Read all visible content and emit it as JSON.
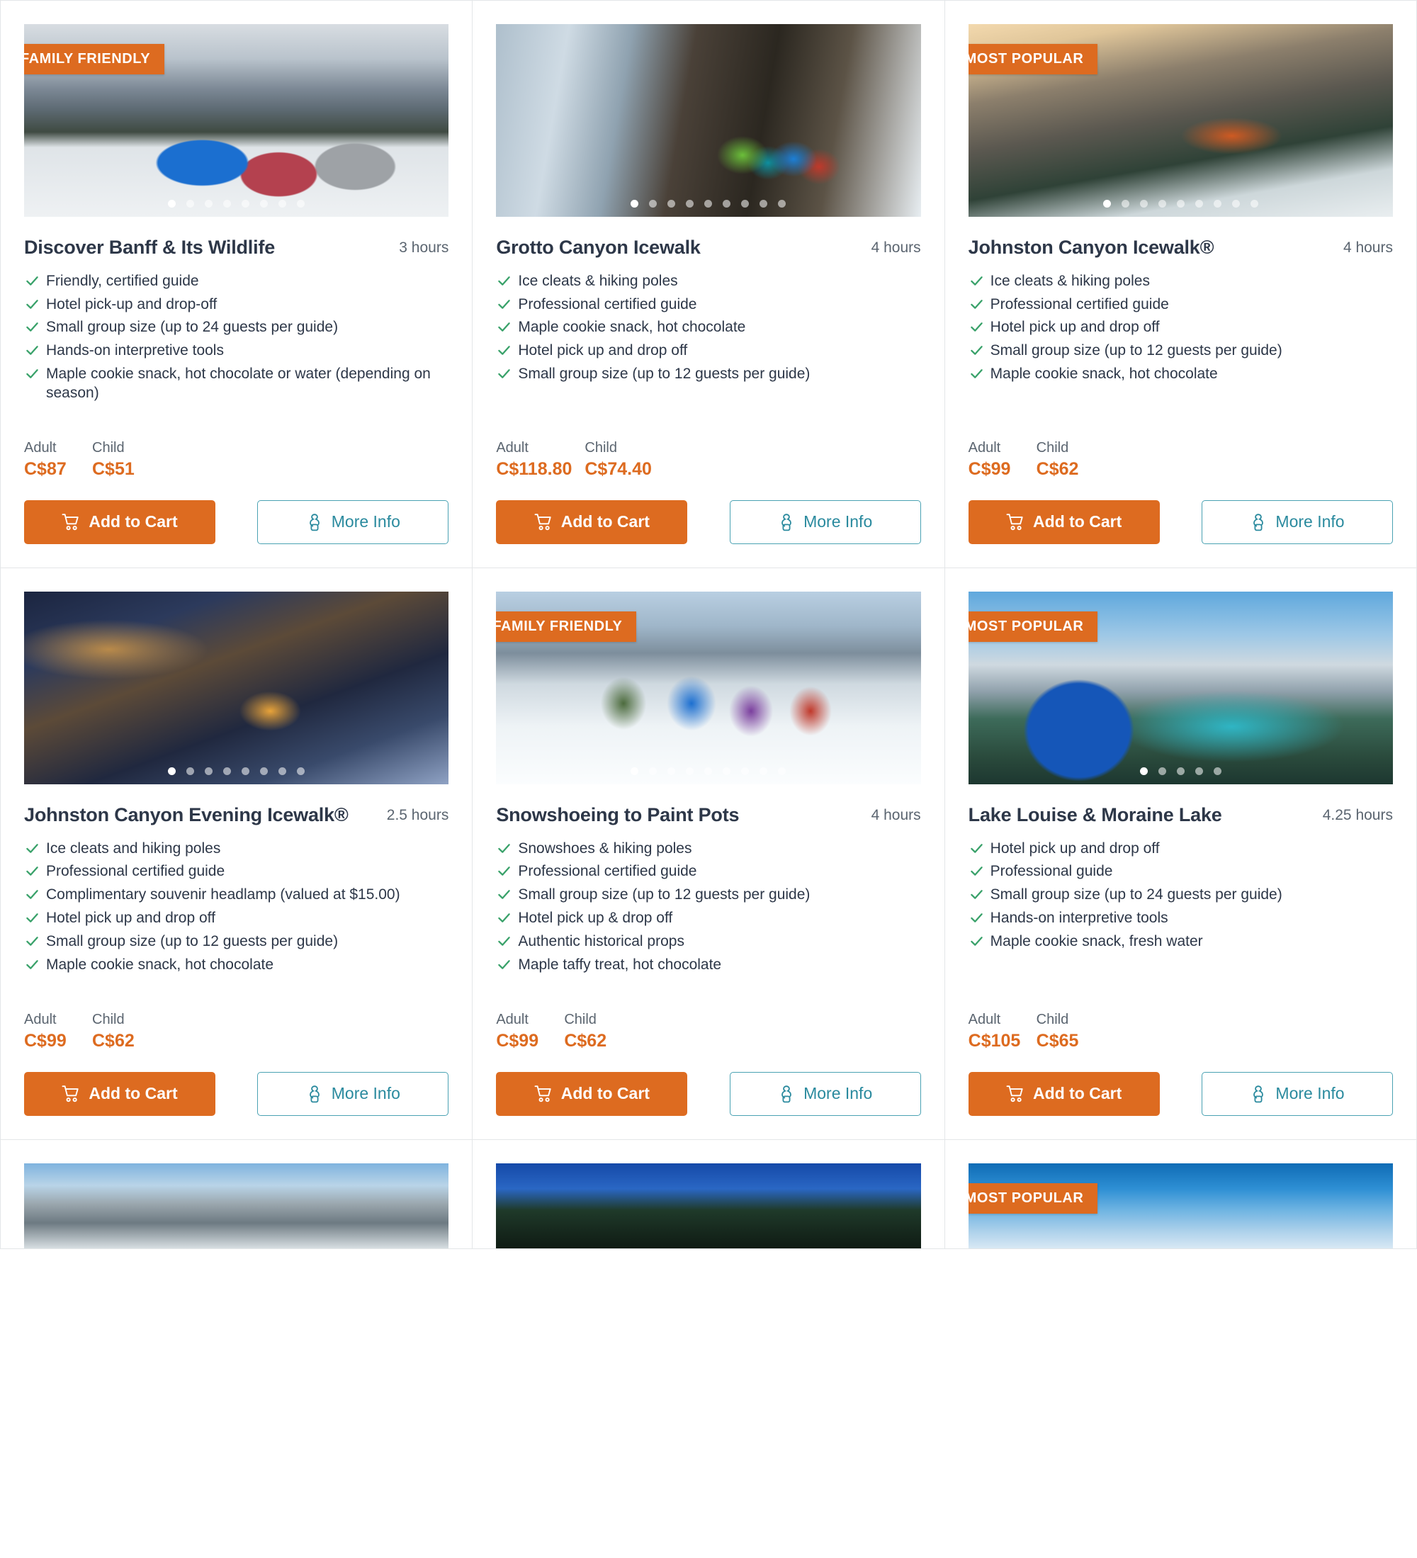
{
  "labels": {
    "adult": "Adult",
    "child": "Child",
    "add_to_cart": "Add to Cart",
    "more_info": "More Info",
    "badge_family": "FAMILY FRIENDLY",
    "badge_popular": "MOST POPULAR"
  },
  "colors": {
    "accent_orange": "#dd6b20",
    "info_teal": "#2a8a9e",
    "check_green": "#38a169",
    "title_dark": "#2d3748",
    "muted_gray": "#5b6570"
  },
  "cards": [
    {
      "title": "Discover Banff & Its Wildlife",
      "duration": "3 hours",
      "badge": "FAMILY FRIENDLY",
      "photo": "ph-wildlife",
      "dots": 8,
      "active_dot": 0,
      "features": [
        "Friendly, certified guide",
        "Hotel pick-up and drop-off",
        "Small group size (up to 24 guests per guide)",
        "Hands-on interpretive tools",
        "Maple cookie snack, hot chocolate or water (depending on season)"
      ],
      "adult_price": "C$87",
      "child_price": "C$51"
    },
    {
      "title": "Grotto Canyon Icewalk",
      "duration": "4 hours",
      "badge": null,
      "photo": "ph-icefall",
      "dots": 9,
      "active_dot": 0,
      "features": [
        "Ice cleats & hiking poles",
        "Professional certified guide",
        "Maple cookie snack, hot chocolate",
        "Hotel pick up and drop off",
        "Small group size (up to 12 guests per guide)"
      ],
      "adult_price": "C$118.80",
      "child_price": "C$74.40"
    },
    {
      "title": "Johnston Canyon Icewalk®",
      "duration": "4 hours",
      "badge": "MOST POPULAR",
      "photo": "ph-johnston",
      "dots": 9,
      "active_dot": 0,
      "features": [
        "Ice cleats & hiking poles",
        "Professional certified guide",
        "Hotel pick up and drop off",
        "Small group size (up to 12 guests per guide)",
        "Maple cookie snack, hot chocolate"
      ],
      "adult_price": "C$99",
      "child_price": "C$62"
    },
    {
      "title": "Johnston Canyon Evening Icewalk®",
      "duration": "2.5 hours",
      "badge": null,
      "photo": "ph-evening",
      "dots": 8,
      "active_dot": 0,
      "features": [
        "Ice cleats and hiking poles",
        "Professional certified guide",
        "Complimentary souvenir headlamp (valued at $15.00)",
        "Hotel pick up and drop off",
        "Small group size (up to 12 guests per guide)",
        "Maple cookie snack, hot chocolate"
      ],
      "adult_price": "C$99",
      "child_price": "C$62"
    },
    {
      "title": "Snowshoeing to Paint Pots",
      "duration": "4 hours",
      "badge": "FAMILY FRIENDLY",
      "photo": "ph-snowshoe",
      "dots": 9,
      "active_dot": 0,
      "features": [
        "Snowshoes & hiking poles",
        "Professional certified guide",
        "Small group size (up to 12 guests per guide)",
        "Hotel pick up & drop off",
        "Authentic historical props",
        "Maple taffy treat, hot chocolate"
      ],
      "adult_price": "C$99",
      "child_price": "C$62"
    },
    {
      "title": "Lake Louise & Moraine Lake",
      "duration": "4.25 hours",
      "badge": "MOST POPULAR",
      "photo": "ph-louise",
      "dots": 5,
      "active_dot": 0,
      "features": [
        "Hotel pick up and drop off",
        "Professional guide",
        "Small group size (up to 24 guests per guide)",
        "Hands-on interpretive tools",
        "Maple cookie snack, fresh water"
      ],
      "adult_price": "C$105",
      "child_price": "C$65"
    }
  ],
  "partial_cards": [
    {
      "badge": null,
      "photo": "ph-mount"
    },
    {
      "badge": null,
      "photo": "ph-forest"
    },
    {
      "badge": "MOST POPULAR",
      "photo": "ph-blue"
    }
  ]
}
